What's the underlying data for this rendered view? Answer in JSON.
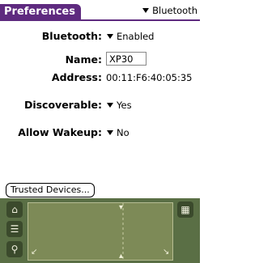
{
  "header": {
    "title": "Preferences",
    "section_dropdown": "Bluetooth"
  },
  "form": {
    "bluetooth_label": "Bluetooth:",
    "bluetooth_value": "Enabled",
    "name_label": "Name:",
    "name_value": "XP30",
    "address_label": "Address:",
    "address_value": "00:11:F6:40:05:35",
    "discoverable_label": "Discoverable:",
    "discoverable_value": "Yes",
    "wakeup_label": "Allow Wakeup:",
    "wakeup_value": "No"
  },
  "buttons": {
    "trusted_devices": "Trusted Devices..."
  },
  "colors": {
    "title_bar": "#5e2a7f",
    "graffiti_background": "#5a6f45",
    "graffiti_area": "#7d8a57"
  },
  "icons": [
    "home-icon",
    "menu-icon",
    "find-icon",
    "calculator-icon"
  ]
}
